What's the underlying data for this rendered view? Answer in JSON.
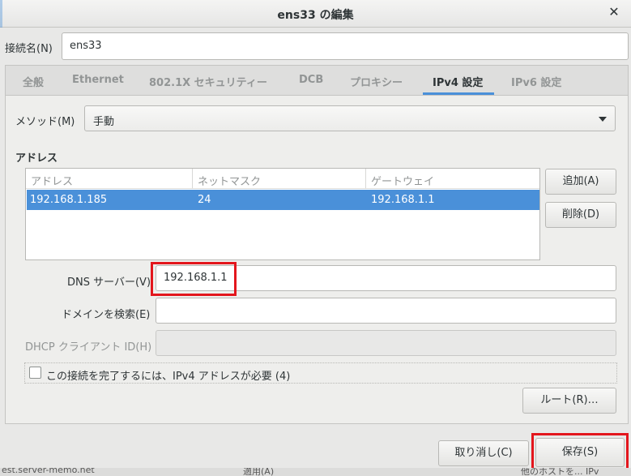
{
  "window": {
    "title": "ens33 の編集",
    "close_glyph": "✕"
  },
  "connection": {
    "label": "接続名(N)",
    "value": "ens33"
  },
  "tabs": [
    {
      "label": "全般"
    },
    {
      "label": "Ethernet"
    },
    {
      "label": "802.1X セキュリティー"
    },
    {
      "label": "DCB"
    },
    {
      "label": "プロキシー"
    },
    {
      "label": "IPv4 設定",
      "active": true
    },
    {
      "label": "IPv6 設定"
    }
  ],
  "method": {
    "label": "メソッド(M)",
    "value": "手動"
  },
  "addresses": {
    "section_title": "アドレス",
    "columns": [
      "アドレス",
      "ネットマスク",
      "ゲートウェイ"
    ],
    "rows": [
      {
        "address": "192.168.1.185",
        "netmask": "24",
        "gateway": "192.168.1.1",
        "selected": true
      }
    ],
    "add_label": "追加(A)",
    "delete_label": "削除(D)"
  },
  "dns": {
    "label": "DNS サーバー(V)",
    "value": "192.168.1.1"
  },
  "search_domains": {
    "label": "ドメインを検索(E)",
    "value": ""
  },
  "dhcp_client_id": {
    "label": "DHCP クライアント ID(H)",
    "value": ""
  },
  "require_ipv4": {
    "label": "この接続を完了するには、IPv4 アドレスが必要 (4)",
    "checked": false
  },
  "routes_label": "ルート(R)…",
  "footer": {
    "cancel_label": "取り消し(C)",
    "save_label": "保存(S)"
  },
  "background_text": {
    "left": "est.server-memo.net",
    "mid": "適用(A)",
    "right": "他のホストを... IPv"
  },
  "colors": {
    "accent": "#4a90d9",
    "highlight_box": "#e3161d"
  }
}
